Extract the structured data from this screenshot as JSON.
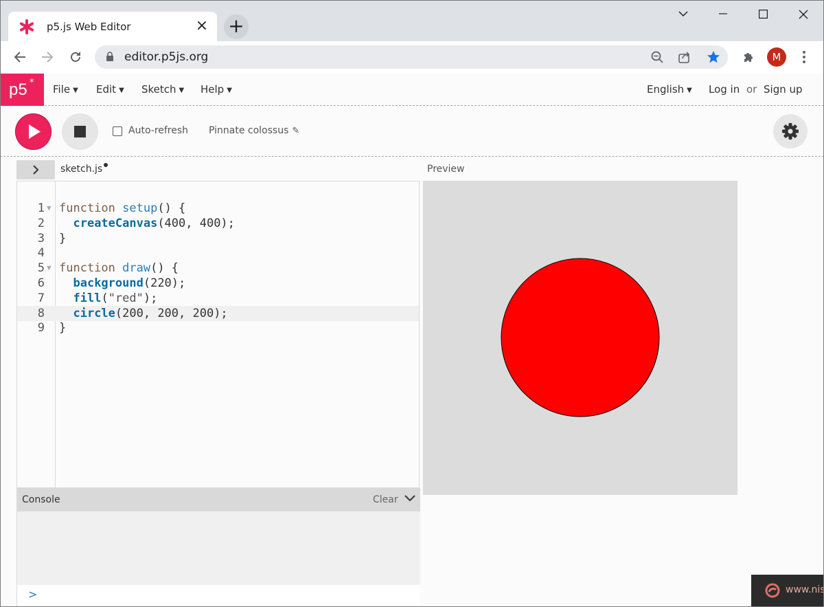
{
  "browser": {
    "tab_title": "p5.js Web Editor",
    "url": "editor.p5js.org",
    "avatar_letter": "M"
  },
  "app": {
    "logo": "p5",
    "logo_star": "*",
    "menus": [
      {
        "label": "File"
      },
      {
        "label": "Edit"
      },
      {
        "label": "Sketch"
      },
      {
        "label": "Help"
      }
    ],
    "language": "English",
    "login": "Log in",
    "or": "or",
    "signup": "Sign up",
    "colors": {
      "brand": "#ed225d"
    }
  },
  "controls": {
    "auto_refresh_label": "Auto-refresh",
    "auto_refresh_checked": false,
    "sketch_name": "Pinnate colossus"
  },
  "editor": {
    "file_name": "sketch.js",
    "active_line": 8,
    "lines": [
      {
        "n": "1",
        "text": "function setup() {"
      },
      {
        "n": "2",
        "text": "  createCanvas(400, 400);"
      },
      {
        "n": "3",
        "text": "}"
      },
      {
        "n": "4",
        "text": ""
      },
      {
        "n": "5",
        "text": "function draw() {"
      },
      {
        "n": "6",
        "text": "  background(220);"
      },
      {
        "n": "7",
        "text": "  fill(\"red\");"
      },
      {
        "n": "8",
        "text": "  circle(200, 200, 200);"
      },
      {
        "n": "9",
        "text": "}"
      }
    ]
  },
  "preview": {
    "label": "Preview",
    "background": "#dcdcdc",
    "circle_fill": "#ff0000"
  },
  "console": {
    "title": "Console",
    "clear_label": "Clear",
    "prompt": ">"
  },
  "badge": {
    "text": "www.nis"
  }
}
